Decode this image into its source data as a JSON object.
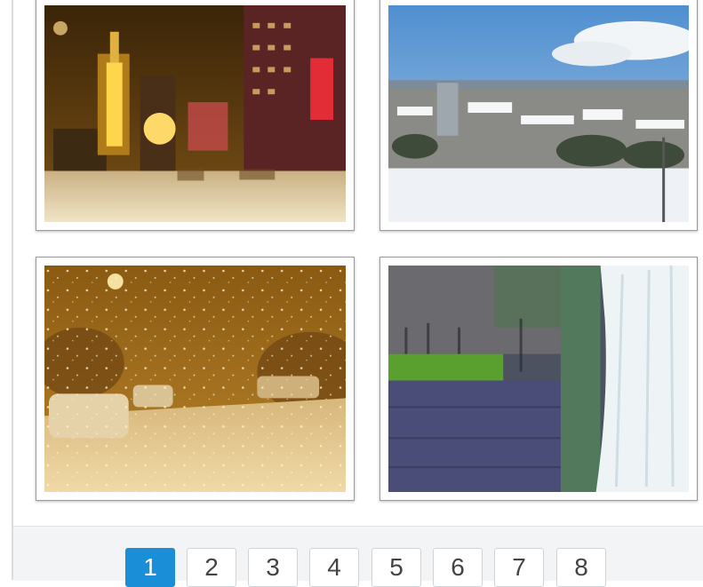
{
  "gallery": {
    "photos": [
      {
        "icon": "night-snow-clocktower-photo"
      },
      {
        "icon": "snowy-city-panorama-photo"
      },
      {
        "icon": "snowfall-street-night-photo"
      },
      {
        "icon": "waterfall-cliff-photo"
      }
    ]
  },
  "pagination": {
    "active": "1",
    "pages": [
      "1",
      "2",
      "3",
      "4",
      "5",
      "6",
      "7",
      "8"
    ]
  },
  "colors": {
    "active_page": "#1a8fd8",
    "pager_background": "#f3f4f5"
  }
}
